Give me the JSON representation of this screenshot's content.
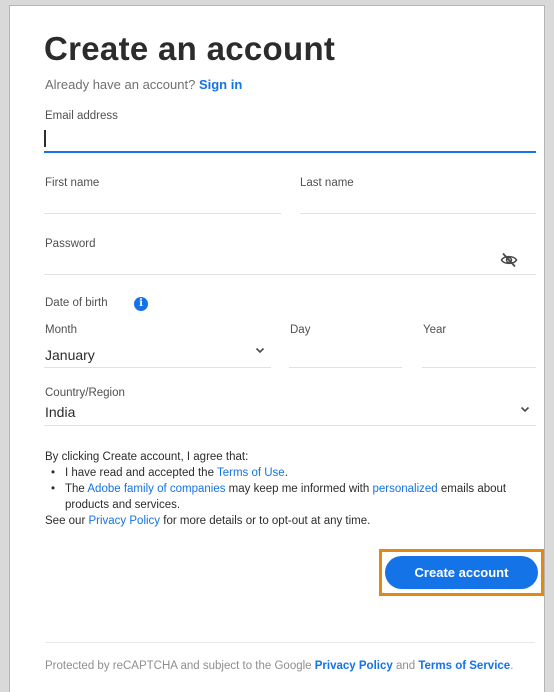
{
  "header": {
    "title": "Create an account",
    "signin_prompt": "Already have an account?",
    "signin_link": "Sign in"
  },
  "form": {
    "email_label": "Email address",
    "email_value": "",
    "first_name_label": "First name",
    "first_name_value": "",
    "last_name_label": "Last name",
    "last_name_value": "",
    "password_label": "Password",
    "password_value": "",
    "dob_label": "Date of birth",
    "month_label": "Month",
    "month_value": "January",
    "day_label": "Day",
    "day_value": "",
    "year_label": "Year",
    "year_value": "",
    "country_label": "Country/Region",
    "country_value": "India"
  },
  "terms": {
    "intro": "By clicking Create account, I agree that:",
    "b1_pre": "I have read and accepted the ",
    "b1_link": "Terms of Use",
    "b1_post": ".",
    "b2_pre": "The ",
    "b2_link1": "Adobe family of companies",
    "b2_mid": " may keep me informed with ",
    "b2_link2": "personalized",
    "b2_post": " emails about products and services.",
    "privacy_pre": "See our ",
    "privacy_link": "Privacy Policy",
    "privacy_post": " for more details or to opt-out at any time."
  },
  "cta": {
    "label": "Create account"
  },
  "footer": {
    "pre": "Protected by reCAPTCHA and subject to the Google ",
    "privacy_link": "Privacy Policy",
    "and": " and ",
    "terms_link": "Terms of Service",
    "post": "."
  },
  "colors": {
    "accent": "#1473e6",
    "highlight": "#e08a13"
  },
  "icons": {
    "info": "info-icon",
    "password_visibility": "eye-off-icon",
    "dropdown": "chevron-down-icon"
  }
}
